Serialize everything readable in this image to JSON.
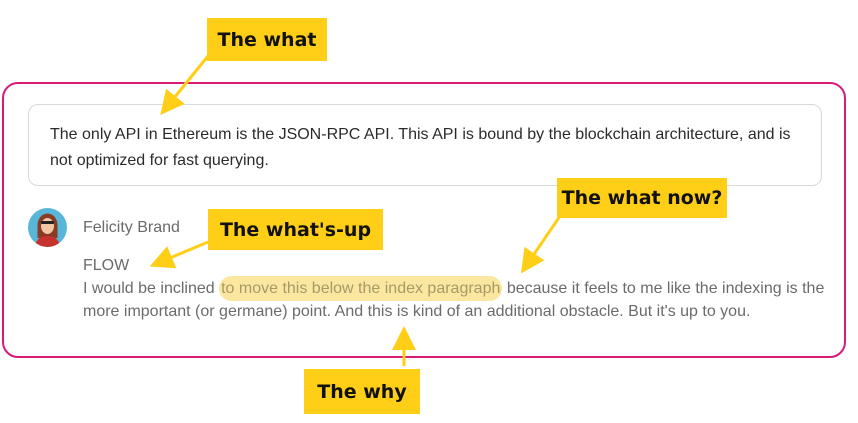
{
  "quote": {
    "text": "The only API in Ethereum is the JSON-RPC API. This API is bound by the blockchain architecture, and is not optimized for fast querying."
  },
  "comment": {
    "author_first": "Felicity",
    "author_last": "Brand",
    "label": "FLOW",
    "text_before": "I would be inclined ",
    "text_highlight": "to move this below the index paragraph",
    "text_after": " because it feels to me like the indexing is the more important (or germane) point. And this is kind of an additional obstacle. But it's up to you."
  },
  "callouts": {
    "what": "The what",
    "what_now": "The what now?",
    "whats_up": "The what's-up",
    "why": "The why"
  },
  "colors": {
    "card_border": "#d81b7a",
    "callout_bg": "#ffce16",
    "highlight_bg": "#fbe7a0"
  },
  "icons": {
    "avatar": "avatar-portrait",
    "arrow": "arrow-icon"
  }
}
